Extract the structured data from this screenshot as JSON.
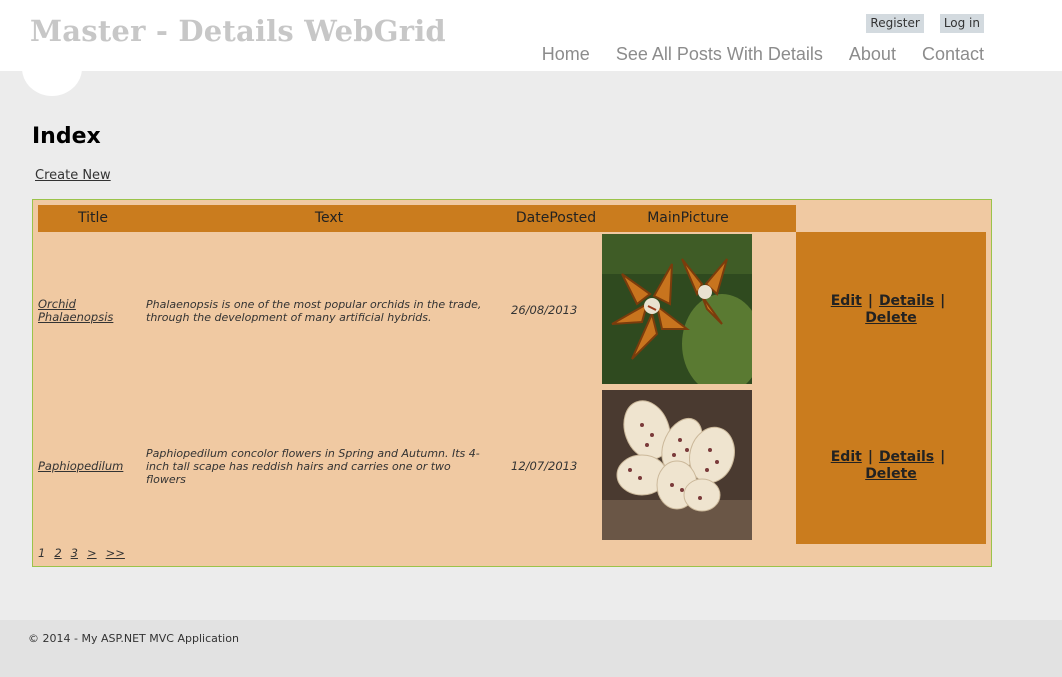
{
  "header": {
    "site_title": "Master - Details WebGrid",
    "register_label": "Register",
    "login_label": "Log in",
    "nav": [
      {
        "label": "Home"
      },
      {
        "label": "See All Posts With Details"
      },
      {
        "label": "About"
      },
      {
        "label": "Contact"
      }
    ]
  },
  "main": {
    "page_title": "Index",
    "create_new_label": "Create New",
    "grid": {
      "columns": [
        "Title",
        "Text",
        "DatePosted",
        "MainPicture"
      ],
      "rows": [
        {
          "title": "Orchid Phalaenopsis",
          "text": "Phalaenopsis is one of the most popular orchids in the trade, through the development of many artificial hybrids.",
          "date": "26/08/2013",
          "picture_icon": "orchid-phalaenopsis-image",
          "edit": "Edit",
          "details": "Details",
          "delete": "Delete"
        },
        {
          "title": "Paphiopedilum",
          "text": "Paphiopedilum concolor flowers in Spring and Autumn. Its 4-inch tall scape has reddish hairs and carries one or two flowers",
          "date": "12/07/2013",
          "picture_icon": "orchid-paphiopedilum-image",
          "edit": "Edit",
          "details": "Details",
          "delete": "Delete"
        }
      ],
      "action_separator": "|",
      "pager": [
        "1",
        "2",
        "3",
        ">",
        ">>"
      ]
    }
  },
  "footer": {
    "text": "© 2014 - My ASP.NET MVC Application"
  },
  "colors": {
    "header_bg": "#ffffff",
    "page_bg": "#ececec",
    "grid_bg": "#f0c9a2",
    "grid_accent": "#ca7c1e",
    "grid_border": "#9bc34a",
    "footer_bg": "#e2e2e2"
  }
}
